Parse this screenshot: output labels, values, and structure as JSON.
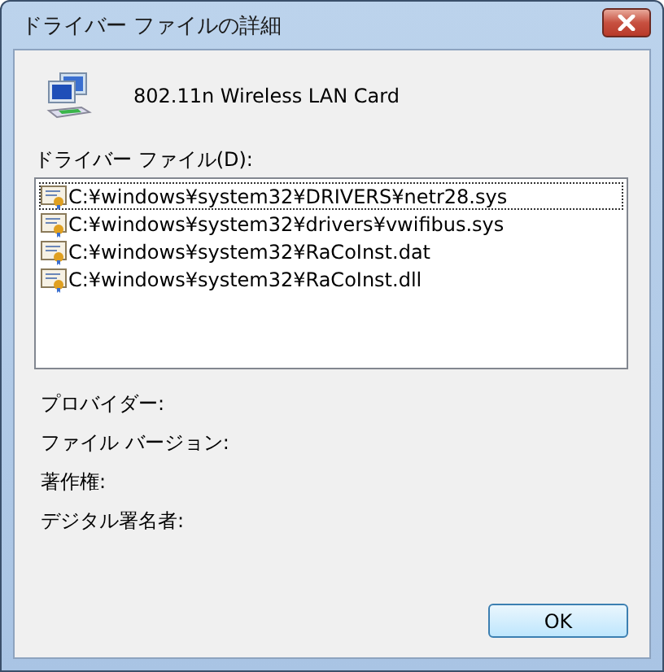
{
  "window": {
    "title": "ドライバー ファイルの詳細"
  },
  "device": {
    "name": "802.11n Wireless LAN Card"
  },
  "files_label": "ドライバー ファイル(D):",
  "files": [
    {
      "path": "C:¥windows¥system32¥DRIVERS¥netr28.sys",
      "focused": true
    },
    {
      "path": "C:¥windows¥system32¥drivers¥vwifibus.sys",
      "focused": false
    },
    {
      "path": "C:¥windows¥system32¥RaCoInst.dat",
      "focused": false
    },
    {
      "path": "C:¥windows¥system32¥RaCoInst.dll",
      "focused": false
    }
  ],
  "properties": [
    "プロバイダー:",
    "ファイル バージョン:",
    "著作権:",
    "デジタル署名者:"
  ],
  "buttons": [
    "OK"
  ]
}
